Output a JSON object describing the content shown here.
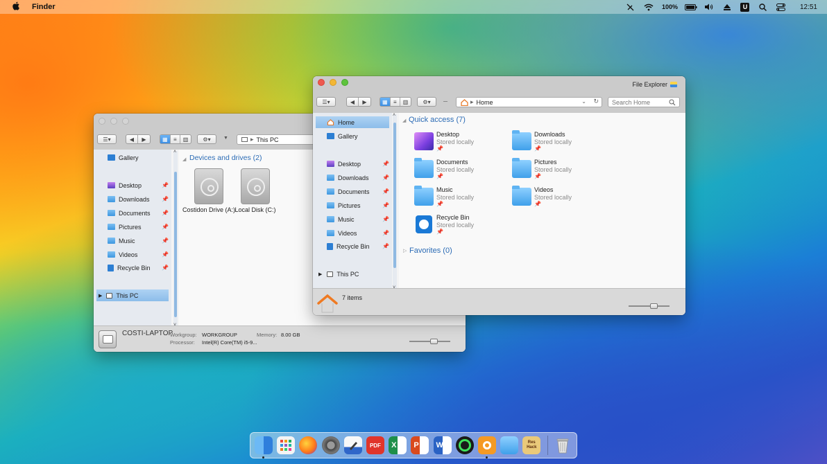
{
  "menubar": {
    "app_name": "Finder",
    "battery": "100%",
    "clock": "12:51",
    "u_badge": "U",
    "icons": [
      "apple-icon",
      "pen-off-icon",
      "wifi-icon",
      "battery-icon",
      "volume-icon",
      "eject-icon",
      "search-icon",
      "control-center-icon"
    ]
  },
  "back_window": {
    "title": "This PC",
    "address": "This PC",
    "sidebar": {
      "items": [
        {
          "label": "Gallery",
          "icon": "gallery-icon"
        },
        {
          "label": "Desktop",
          "icon": "desktop-folder-icon"
        },
        {
          "label": "Downloads",
          "icon": "folder-icon"
        },
        {
          "label": "Documents",
          "icon": "folder-icon"
        },
        {
          "label": "Pictures",
          "icon": "folder-icon"
        },
        {
          "label": "Music",
          "icon": "folder-icon"
        },
        {
          "label": "Videos",
          "icon": "folder-icon"
        },
        {
          "label": "Recycle Bin",
          "icon": "recycle-bin-icon"
        },
        {
          "label": "This PC",
          "icon": "pc-icon"
        }
      ]
    },
    "section": "Devices and drives (2)",
    "drives": [
      {
        "label": "Costidon Drive (A:)"
      },
      {
        "label": "Local Disk (C:)"
      }
    ],
    "status": {
      "computer_name": "COSTI-LAPTOP",
      "workgroup_label": "Workgroup:",
      "workgroup_value": "WORKGROUP",
      "memory_label": "Memory:",
      "memory_value": "8.00 GB",
      "processor_label": "Processor:",
      "processor_value": "Intel(R) Core(TM) i5-9..."
    }
  },
  "front_window": {
    "title": "File Explorer",
    "address": "Home",
    "search_placeholder": "Search Home",
    "sidebar": {
      "items": [
        {
          "label": "Home",
          "icon": "home-icon"
        },
        {
          "label": "Gallery",
          "icon": "gallery-icon"
        },
        {
          "label": "Desktop",
          "icon": "desktop-folder-icon"
        },
        {
          "label": "Downloads",
          "icon": "folder-icon"
        },
        {
          "label": "Documents",
          "icon": "folder-icon"
        },
        {
          "label": "Pictures",
          "icon": "folder-icon"
        },
        {
          "label": "Music",
          "icon": "folder-icon"
        },
        {
          "label": "Videos",
          "icon": "folder-icon"
        },
        {
          "label": "Recycle Bin",
          "icon": "recycle-bin-icon"
        },
        {
          "label": "This PC",
          "icon": "pc-icon"
        }
      ]
    },
    "quick_access_header": "Quick access (7)",
    "favorites_header": "Favorites (0)",
    "quick_access": [
      {
        "name": "Desktop",
        "sub": "Stored locally"
      },
      {
        "name": "Downloads",
        "sub": "Stored locally"
      },
      {
        "name": "Documents",
        "sub": "Stored locally"
      },
      {
        "name": "Pictures",
        "sub": "Stored locally"
      },
      {
        "name": "Music",
        "sub": "Stored locally"
      },
      {
        "name": "Videos",
        "sub": "Stored locally"
      },
      {
        "name": "Recycle Bin",
        "sub": "Stored locally"
      }
    ],
    "status_text": "7 items"
  },
  "dock": {
    "apps": [
      {
        "name": "finder-icon",
        "color": "#3a8ee6"
      },
      {
        "name": "launchpad-icon",
        "color": "#f0f0f0"
      },
      {
        "name": "firefox-icon",
        "color": "#ff7a1a"
      },
      {
        "name": "system-settings-icon",
        "color": "#6d6d6d"
      },
      {
        "name": "pen-app-icon",
        "color": "#2f66c9"
      },
      {
        "name": "pdf-app-icon",
        "color": "#e0352b",
        "text": "PDF"
      },
      {
        "name": "excel-icon",
        "color": "#1f8f4a"
      },
      {
        "name": "powerpoint-icon",
        "color": "#d94a1e"
      },
      {
        "name": "word-icon",
        "color": "#2a62c4"
      },
      {
        "name": "gauge-app-icon",
        "color": "#1a1a1a"
      },
      {
        "name": "orange-app-icon",
        "color": "#f59a24"
      },
      {
        "name": "folder-app-icon",
        "color": "#59b4f0"
      },
      {
        "name": "resource-hacker-icon",
        "color": "#7a3e16",
        "text": "Resource Hacker"
      }
    ],
    "trash": "trash-icon"
  }
}
